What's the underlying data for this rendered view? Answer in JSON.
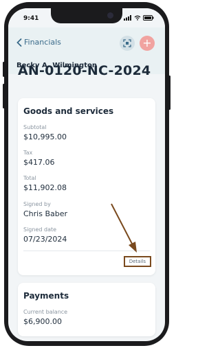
{
  "status_bar": {
    "time": "9:41"
  },
  "header": {
    "back_label": "Financials",
    "add_label": "+",
    "person_name": "Becky A. Wilmington"
  },
  "document": {
    "id": "AN-0120-NC-2024"
  },
  "goods_services": {
    "title": "Goods and services",
    "subtotal_label": "Subtotal",
    "subtotal_value": "$10,995.00",
    "tax_label": "Tax",
    "tax_value": "$417.06",
    "total_label": "Total",
    "total_value": "$11,902.08",
    "signed_by_label": "Signed by",
    "signed_by_value": "Chris Baber",
    "signed_date_label": "Signed date",
    "signed_date_value": "07/23/2024",
    "details_label": "Details"
  },
  "payments": {
    "title": "Payments",
    "current_balance_label": "Current balance",
    "current_balance_value": "$6,900.00"
  },
  "colors": {
    "accent": "#3a6b8a",
    "annotation": "#7a4a1e",
    "add_button": "#f1a3a0"
  },
  "icons": {
    "back": "chevron-left-icon",
    "scan": "scan-icon",
    "add": "plus-icon"
  }
}
